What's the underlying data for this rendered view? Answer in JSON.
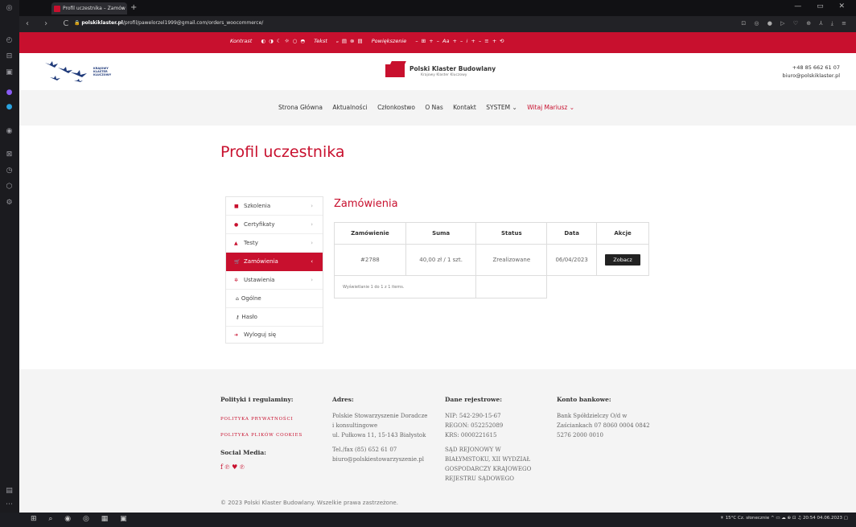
{
  "browser": {
    "tab_title": "Profil uczestnika – Zamów",
    "tab_close": "×",
    "new_tab": "+",
    "url_domain": "polskiklaster.pl",
    "url_path": "/profil/pawelorzel1999@gmail.com/orders_woocommerce/",
    "nav_icons": "‹ › C",
    "window_controls": "— ▭ ✕"
  },
  "accessibility_bar": {
    "contrast_label": "Kontrast",
    "contrast_icons": "◐ ◑ ☾ ☼ ○ ◓",
    "text_label": "Tekst",
    "text_icons": "ₒ ▤ ⊗ ▤",
    "zoom_label": "Powiększenie",
    "zoom_controls": "– ⊞ +   – Aa +   – ⁞ +   – ≡ +   ⟲"
  },
  "header": {
    "left_logo_text": "KRAJOWY KLASTER KLUCZOWY",
    "center_logo_name": "Polski Klaster Budowlany",
    "center_logo_sub": "Krajowy Klaster Kluczowy",
    "phone": "+48 85 662 61 07",
    "email": "biuro@polskiklaster.pl"
  },
  "menu": {
    "items": [
      "Strona Główna",
      "Aktualności",
      "Członkostwo",
      "O Nas",
      "Kontakt",
      "SYSTEM ⌄"
    ],
    "user": "Witaj Mariusz ⌄"
  },
  "page_title": "Profil uczestnika",
  "sidebar_menu": {
    "items": [
      {
        "label": "Szkolenia",
        "icon": "book-icon"
      },
      {
        "label": "Certyfikaty",
        "icon": "certificate-icon"
      },
      {
        "label": "Testy",
        "icon": "test-icon"
      },
      {
        "label": "Zamówienia",
        "icon": "cart-icon"
      },
      {
        "label": "Ustawienia",
        "icon": "gear-icon"
      }
    ],
    "sub_items": [
      {
        "label": "Ogólne",
        "icon": "home-icon"
      },
      {
        "label": "Hasło",
        "icon": "key-icon"
      }
    ],
    "logout": "Wyloguj się"
  },
  "orders": {
    "section_title": "Zamówienia",
    "columns": [
      "Zamówienie",
      "Suma",
      "Status",
      "Data",
      "Akcje"
    ],
    "rows": [
      {
        "order": "#2788",
        "sum": "40,00 zł / 1 szt.",
        "status": "Zrealizowane",
        "date": "06/04/2023",
        "action": "Zobacz"
      }
    ],
    "footer_text": "Wyświetlanie 1 do 1 z 1 items."
  },
  "footer": {
    "col1_title": "Polityki i regulaminy:",
    "link_privacy": "POLITYKA PRYWATNOŚCI",
    "link_cookies": "POLITYKA PLIKÓW COOKIES",
    "social_title": "Social Media:",
    "social_icons": "f ℗ ♥ ℗",
    "col2_title": "Adres:",
    "addr_1": "Polskie Stowarzyszenie Doradcze",
    "addr_2": "i konsultingowe",
    "addr_3": "ul. Pułkowa 11, 15-143 Białystok",
    "addr_4": "Tel./fax (85) 652 61 07",
    "addr_5": "biuro@polskiestowarzyszenie.pl",
    "col3_title": "Dane rejestrowe:",
    "reg_1": "NIP: 542-290-15-67",
    "reg_2": "REGON: 052252089",
    "reg_3": "KRS: 0000221615",
    "reg_4": "SĄD REJONOWY W",
    "reg_5": "BIAŁYMSTOKU, XII WYDZIAŁ",
    "reg_6": "GOSPODARCZY KRAJOWEGO",
    "reg_7": "REJESTRU SĄDOWEGO",
    "col4_title": "Konto bankowe:",
    "bank_1": "Bank Spółdzielczy O/d w",
    "bank_2": "Zaściankach 07 8060 0004 0842",
    "bank_3": "5276 2000 0010",
    "copyright": "© 2023 Polski Klaster Budowlany. Wszelkie prawa zastrzeżone."
  },
  "taskbar": {
    "weather": "15°C Cz. słonecznie",
    "time": "20:54",
    "date": "04.06.2023"
  },
  "colors": {
    "brand_red": "#c8102e",
    "dark": "#222222"
  }
}
